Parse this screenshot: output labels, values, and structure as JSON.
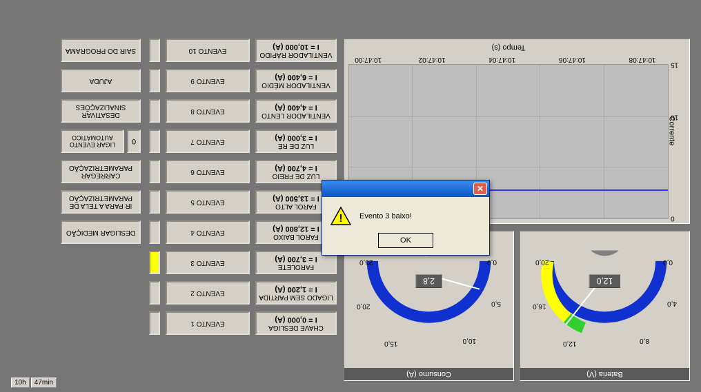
{
  "clock": {
    "hours": "10h",
    "minutes": "47min"
  },
  "gauges": {
    "battery": {
      "title": "Bateria (V)",
      "value": "12,0",
      "ticks": [
        "0,0",
        "4,0",
        "8,0",
        "12,0",
        "16,0",
        "20,0"
      ]
    },
    "consumption": {
      "title": "Consumo (A)",
      "value": "2,8",
      "ticks": [
        "0,0",
        "5,0",
        "10,0",
        "15,0",
        "20,0",
        "25,0"
      ]
    }
  },
  "chart": {
    "ylabel": "Corrente",
    "xlabel": "Tempo (s)",
    "legend": "Corrente",
    "yticks": [
      "0",
      "10",
      "15"
    ],
    "xticks": [
      "10:47:08",
      "10:47:06",
      "10:47:04",
      "10:47:02",
      "10:47:00"
    ]
  },
  "chart_data": {
    "type": "line",
    "title": "",
    "xlabel": "Tempo (s)",
    "ylabel": "Corrente",
    "ylim": [
      0,
      15
    ],
    "x": [
      "10:47:00",
      "10:47:02",
      "10:47:04",
      "10:47:06",
      "10:47:08"
    ],
    "series": [
      {
        "name": "Corrente",
        "values": [
          2.8,
          2.8,
          2.8,
          2.8,
          2.8
        ]
      }
    ]
  },
  "params": [
    {
      "label": "CHAVE DESLIGA",
      "readout": "I = 0,000 (A)"
    },
    {
      "label": "LIGADO SEM PARTIDA",
      "readout": "I = 1,200 (A)"
    },
    {
      "label": "FAROLETE",
      "readout": "I = 3,700 (A)"
    },
    {
      "label": "FAROL BAIXO",
      "readout": "I = 12,800 (A)"
    },
    {
      "label": "FAROL ALTO",
      "readout": "I = 13,500 (A)"
    },
    {
      "label": "LUZ DE FREIO",
      "readout": "I = 4,700 (A)"
    },
    {
      "label": "LUZ DE RÉ",
      "readout": "I = 3,000 (A)"
    },
    {
      "label": "VENTILADOR LENTO",
      "readout": "I = 4,400 (A)"
    },
    {
      "label": "VENTILADOR MÉDIO",
      "readout": "I = 6,400 (A)"
    },
    {
      "label": "VENTILADOR RÁPIDO",
      "readout": "I = 10,000 (A)"
    }
  ],
  "events": [
    {
      "label": "EVENTO 1",
      "active": false
    },
    {
      "label": "EVENTO 2",
      "active": false
    },
    {
      "label": "EVENTO 3",
      "active": true
    },
    {
      "label": "EVENTO 4",
      "active": false
    },
    {
      "label": "EVENTO 5",
      "active": false
    },
    {
      "label": "EVENTO 6",
      "active": false
    },
    {
      "label": "EVENTO 7",
      "active": false
    },
    {
      "label": "EVENTO 8",
      "active": false
    },
    {
      "label": "EVENTO 9",
      "active": false
    },
    {
      "label": "EVENTO 10",
      "active": false
    }
  ],
  "actions": {
    "desligar_medicao": "DESLIGAR MEDIÇÃO",
    "ir_parametrizacao": "IR PARA A TELA DE PARAMETRIZAÇÃO",
    "carregar_parametrizacao": "CARREGAR PARAMETRIZAÇÃO",
    "ligar_evento_automatico": "LIGAR EVENTO AUTOMÁTICO",
    "auto_count": "0",
    "desativar_sinalizacoes": "DESATIVAR SINALIZAÇÕES",
    "ajuda": "AJUDA",
    "sair": "SAIR DO PROGRAMA"
  },
  "dialog": {
    "message": "Evento 3 baixo!",
    "ok": "OK"
  }
}
